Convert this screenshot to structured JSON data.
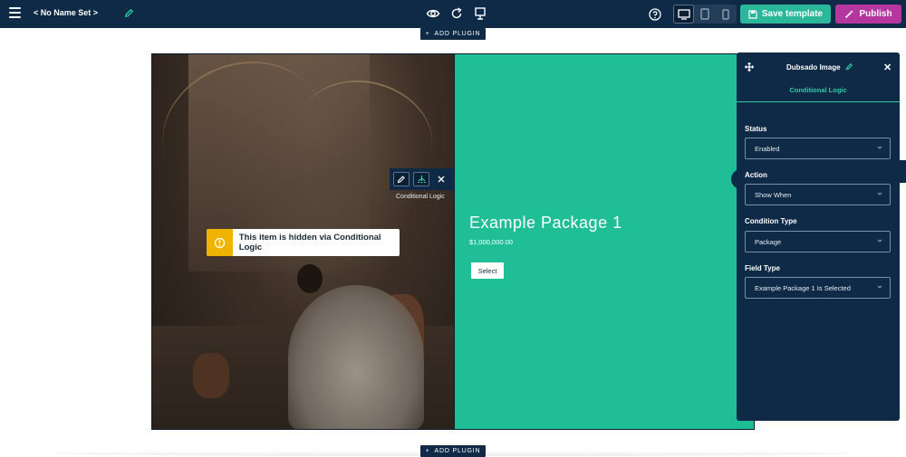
{
  "topbar": {
    "set_name": "< No Name Set >",
    "save_label": "Save template",
    "publish_label": "Publish",
    "icons": [
      "menu-icon",
      "pencil-icon",
      "eye-icon",
      "redo-icon",
      "device-preview-icon",
      "help-icon",
      "desktop-icon",
      "tablet-icon",
      "mobile-icon",
      "save-icon",
      "magic-wand-icon"
    ],
    "active_device": "desktop"
  },
  "add_plugin": {
    "label": "ADD PLUGIN"
  },
  "canvas": {
    "hidden_notice": "This item is hidden via Conditional Logic",
    "element_toolbar_label": "Conditional Logic",
    "package": {
      "title": "Example Package 1",
      "price": "$1,000,000.00",
      "select_label": "Select"
    }
  },
  "panel": {
    "title": "Dubsado Image",
    "tab": "Conditional Logic",
    "fields": [
      {
        "label": "Status",
        "value": "Enabled"
      },
      {
        "label": "Action",
        "value": "Show When"
      },
      {
        "label": "Condition Type",
        "value": "Package"
      },
      {
        "label": "Field Type",
        "value": "Example Package 1 Is Selected"
      }
    ]
  },
  "colors": {
    "navy": "#0e2a47",
    "green": "#1fbe96",
    "save": "#2bb89a",
    "publish": "#b5369e",
    "warning": "#f0b400"
  }
}
